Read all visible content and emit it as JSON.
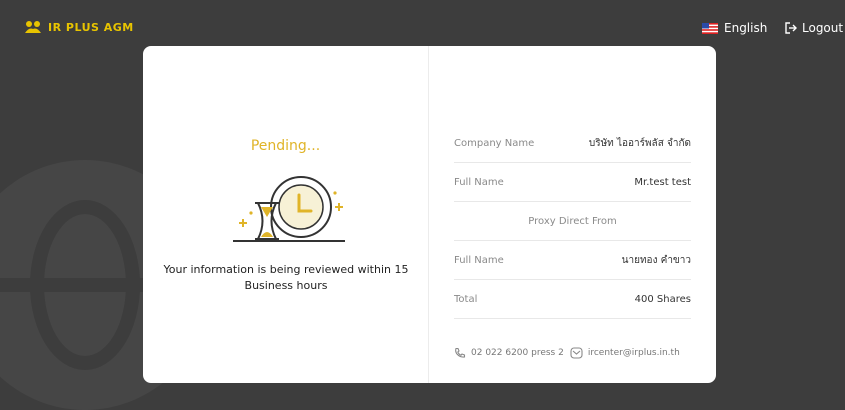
{
  "brand": {
    "name": "IR PLUS AGM",
    "color": "#e8c400"
  },
  "header": {
    "language": "English",
    "logout": "Logout"
  },
  "status": {
    "title": "Pending...",
    "message": "Your information is being reviewed within 15 Business hours"
  },
  "details": {
    "company": {
      "label": "Company Name",
      "value": "บริษัท ไออาร์พลัส จำกัด"
    },
    "holder": {
      "label": "Full Name",
      "value": "Mr.test test"
    },
    "proxy_heading": "Proxy Direct From",
    "proxy": {
      "label": "Full Name",
      "value": "นายทอง คำขาว"
    },
    "total": {
      "label": "Total",
      "value": "400 Shares"
    }
  },
  "contact": {
    "phone": "02 022 6200 press 2",
    "email": "ircenter@irplus.in.th"
  },
  "icons": [
    "handshake-logo-icon",
    "us-flag-icon",
    "logout-icon",
    "hourglass-clock-icon",
    "phone-icon",
    "email-icon"
  ]
}
